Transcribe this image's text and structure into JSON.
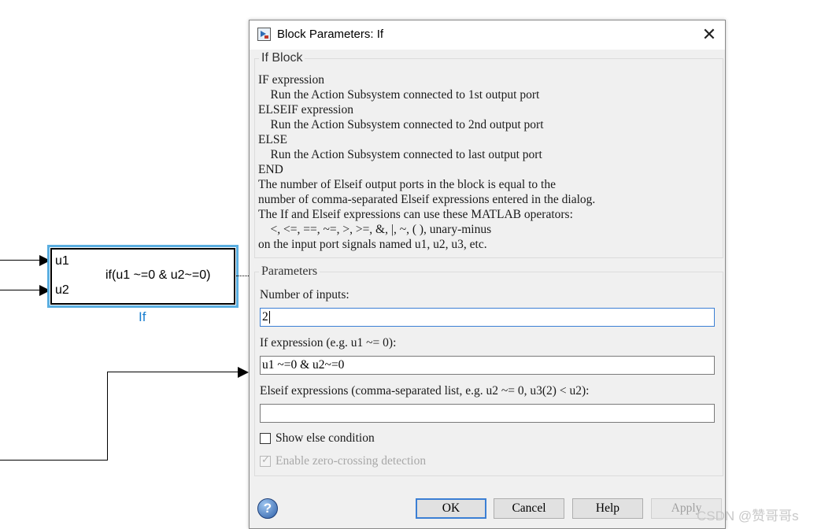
{
  "model": {
    "block": {
      "input_labels": [
        "u1",
        "u2"
      ],
      "expression": "if(u1 ~=0 & u2~=0)",
      "name": "If",
      "selection_color": "#5aaee0",
      "name_color": "#1a7fd0"
    }
  },
  "dialog": {
    "title": "Block Parameters: If",
    "close_glyph": "✕",
    "description_group": {
      "title": "If Block",
      "text": "IF expression\n    Run the Action Subsystem connected to 1st output port\nELSEIF expression\n    Run the Action Subsystem connected to 2nd output port\nELSE\n    Run the Action Subsystem connected to last output port\nEND\nThe number of Elseif output ports in the block is equal to the\nnumber of comma-separated Elseif expressions entered in the dialog.\nThe If and Elseif expressions can use these MATLAB operators:\n    <, <=, ==, ~=, >, >=, &, |, ~, ( ), unary-minus\non the input port signals named u1, u2, u3, etc."
    },
    "parameters_group": {
      "title": "Parameters",
      "number_of_inputs": {
        "label": "Number of inputs:",
        "value": "2"
      },
      "if_expression": {
        "label": "If expression (e.g. u1 ~= 0):",
        "value": "u1 ~=0 & u2~=0"
      },
      "elseif_expressions": {
        "label": "Elseif expressions (comma-separated list, e.g. u2 ~= 0, u3(2) < u2):",
        "value": ""
      },
      "show_else": {
        "label": "Show else condition",
        "checked": false
      },
      "zero_crossing": {
        "label": "Enable zero-crossing detection",
        "checked": true,
        "disabled": true
      }
    },
    "buttons": {
      "ok": "OK",
      "cancel": "Cancel",
      "help": "Help",
      "apply": "Apply"
    },
    "help_icon_glyph": "?"
  },
  "watermark": "CSDN @赞哥哥s"
}
